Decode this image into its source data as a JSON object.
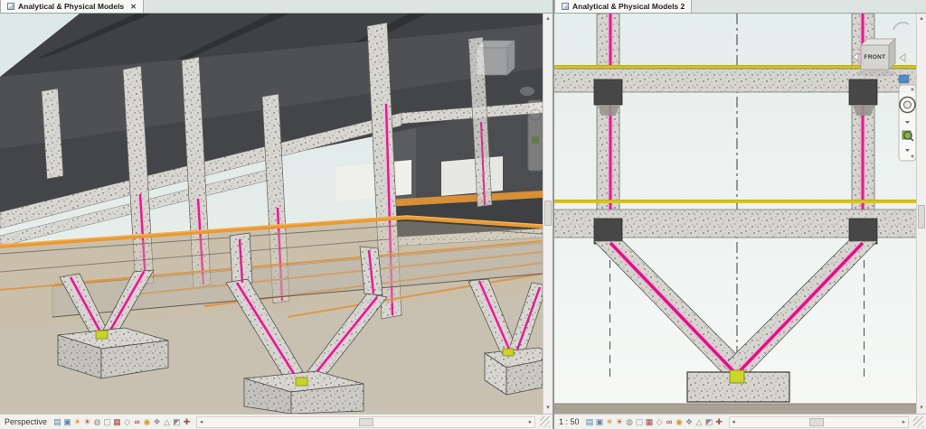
{
  "panes": {
    "left": {
      "tab": {
        "title": "Analytical & Physical Models",
        "close": "✕"
      },
      "status": {
        "scale": "Perspective"
      }
    },
    "right": {
      "tab": {
        "title": "Analytical & Physical Models 2"
      },
      "status": {
        "scale": "1 : 50"
      },
      "viewcube": {
        "label": "FRONT"
      }
    }
  },
  "glyphs": {
    "up": "▴",
    "down": "▾",
    "left": "◂",
    "right": "▸"
  },
  "view_control_icons": [
    {
      "name": "detail-level-icon",
      "glyph": "▤",
      "color": "#4f7fb0"
    },
    {
      "name": "visual-style-icon",
      "glyph": "▣",
      "color": "#5d84ad"
    },
    {
      "name": "sun-path-icon",
      "glyph": "☀",
      "color": "#e08a1e"
    },
    {
      "name": "shadows-icon",
      "glyph": "☀",
      "color": "#b3591f"
    },
    {
      "name": "show-rendering-dialog-icon",
      "glyph": "◍",
      "color": "#87898c"
    },
    {
      "name": "crop-view-icon",
      "glyph": "▢",
      "color": "#8f918d"
    },
    {
      "name": "show-crop-region-icon",
      "glyph": "▦",
      "color": "#9c4a42"
    },
    {
      "name": "unlocked-3d-view-icon",
      "glyph": "◇",
      "color": "#8f918d"
    },
    {
      "name": "temporary-hide-isolate-icon",
      "glyph": "∞",
      "color": "#7a2d2d"
    },
    {
      "name": "reveal-hidden-elements-icon",
      "glyph": "◉",
      "color": "#c9a11f"
    },
    {
      "name": "temporary-view-properties-icon",
      "glyph": "❖",
      "color": "#8a8d90"
    },
    {
      "name": "show-analytical-model-icon",
      "glyph": "△",
      "color": "#7d9c5a"
    },
    {
      "name": "highlight-displacement-sets-icon",
      "glyph": "◩",
      "color": "#8a8d90"
    },
    {
      "name": "reveal-constraints-icon",
      "glyph": "✚",
      "color": "#a05050"
    }
  ],
  "colors": {
    "analytical_line": "#dc1f8f",
    "analytical_halo": "#f2b9d8",
    "deck_orange": "#e89a33",
    "level_yellow": "#d9c513",
    "node_green": "#cbd52c",
    "concrete": "#d8d6d1",
    "slab_dark": "#45474a",
    "ground_left": "#c8c1b1",
    "ground_right": "#a9a295",
    "sky": "#dfe9e7"
  }
}
